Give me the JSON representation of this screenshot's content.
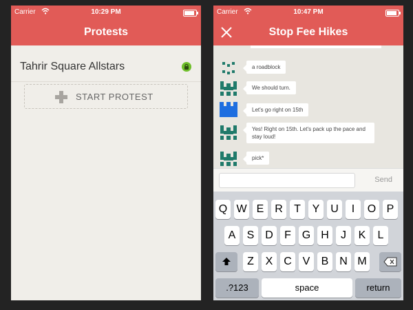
{
  "left": {
    "status": {
      "carrier": "Carrier",
      "time": "10:29 PM"
    },
    "title": "Protests",
    "group_name": "Tahrir Square Allstars",
    "start_label": "START PROTEST"
  },
  "right": {
    "status": {
      "carrier": "Carrier",
      "time": "10:47 PM"
    },
    "title": "Stop Fee Hikes",
    "messages": [
      {
        "text": "a roadblock"
      },
      {
        "text": "We should turn."
      },
      {
        "text": "Let's go right on 15th"
      },
      {
        "text": "Yes! Right on 15th. Let's pack up the pace and stay loud!"
      },
      {
        "text": "pick*"
      }
    ],
    "input_value": "",
    "send_label": "Send",
    "keyboard": {
      "row1": [
        "Q",
        "W",
        "E",
        "R",
        "T",
        "Y",
        "U",
        "I",
        "O",
        "P"
      ],
      "row2": [
        "A",
        "S",
        "D",
        "F",
        "G",
        "H",
        "J",
        "K",
        "L"
      ],
      "row3": [
        "Z",
        "X",
        "C",
        "V",
        "B",
        "N",
        "M"
      ],
      "numbers_label": ".?123",
      "space_label": "space",
      "return_label": "return"
    }
  },
  "colors": {
    "accent": "#e15b57",
    "avatar_green": "#1f7a6a",
    "avatar_blue": "#1e6ee0",
    "lock_green": "#6fbf2a"
  }
}
